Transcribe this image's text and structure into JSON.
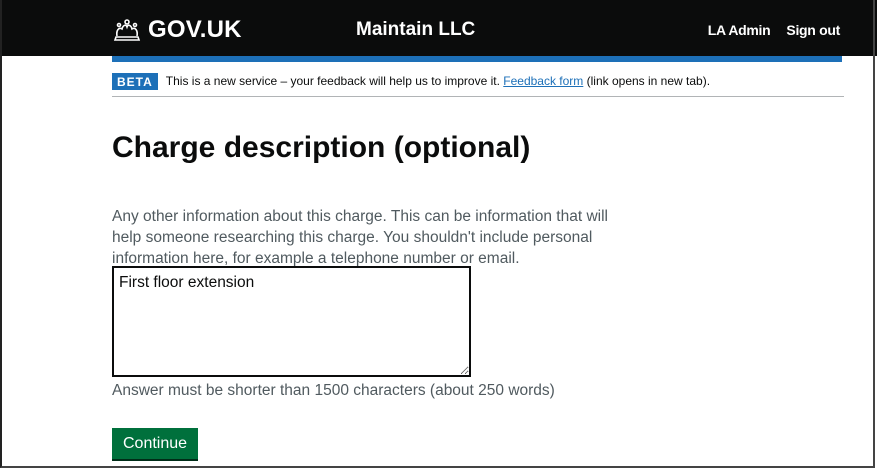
{
  "header": {
    "logo_text": "GOV.UK",
    "logo_icon": "crown-icon",
    "service_name": "Maintain LLC",
    "nav": {
      "admin_label": "LA Admin",
      "sign_out_label": "Sign out"
    },
    "background_color": "#0b0c0c",
    "stripe_color": "#1d70b8"
  },
  "phase_banner": {
    "tag": "BETA",
    "text_before_link": "This is a new service – your feedback will help us to improve it. ",
    "link_text": "Feedback form",
    "text_after_link": " (link opens in new tab)."
  },
  "main": {
    "title": "Charge description (optional)",
    "hint": "Any other information about this charge. This can be information that will help someone researching this charge. You shouldn't include personal information here, for example a telephone number or email.",
    "textarea_value": "First floor extension",
    "character_count_message": "Answer must be shorter than 1500 characters (about 250 words)",
    "continue_label": "Continue",
    "button_color": "#00703c"
  }
}
